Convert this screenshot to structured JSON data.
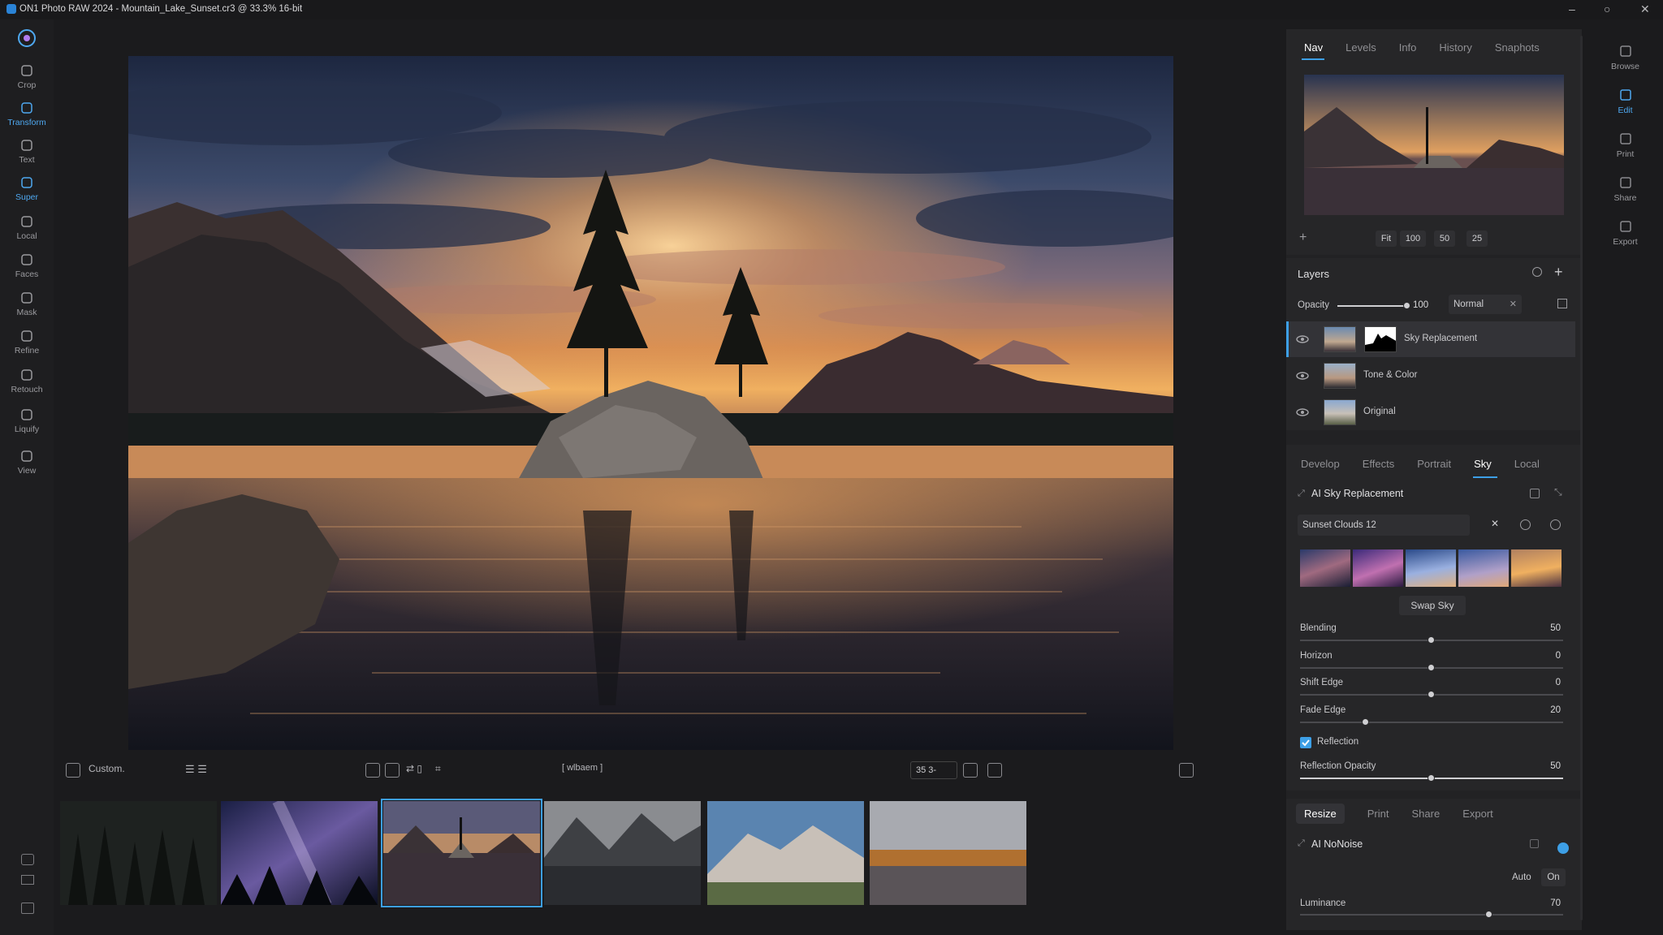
{
  "window": {
    "title": "ON1 Photo RAW 2024 - Mountain_Lake_Sunset.cr3 @ 33.3% 16-bit"
  },
  "left_tools": [
    {
      "label": "Crop",
      "icon": "crop-icon"
    },
    {
      "label": "Transform",
      "icon": "transform-icon"
    },
    {
      "label": "Text",
      "icon": "text-icon"
    },
    {
      "label": "Super",
      "icon": "super-icon"
    },
    {
      "label": "Local",
      "icon": "brush-icon"
    },
    {
      "label": "Faces",
      "icon": "face-icon"
    },
    {
      "label": "Mask",
      "icon": "mask-icon"
    },
    {
      "label": "Refine",
      "icon": "refine-brush-icon"
    },
    {
      "label": "Retouch",
      "icon": "retouch-icon"
    },
    {
      "label": "Liquify",
      "icon": "liquify-icon"
    },
    {
      "label": "View",
      "icon": "view-icon"
    }
  ],
  "right_tools": [
    {
      "label": "Browse",
      "icon": "browse-icon"
    },
    {
      "label": "Edit",
      "icon": "edit-icon"
    },
    {
      "label": "Print",
      "icon": "print-icon"
    },
    {
      "label": "Share",
      "icon": "share-icon"
    },
    {
      "label": "Export",
      "icon": "export-icon"
    }
  ],
  "viewbar": {
    "preset": "Custom.",
    "zoom_readout": "35 3-",
    "mid_label": "[ wlbaem ]"
  },
  "nav": {
    "tabs": [
      "Nav",
      "Levels",
      "Info",
      "History",
      "Snaphots"
    ],
    "zoom_buttons": [
      "Fit",
      "100",
      "50",
      "25"
    ]
  },
  "layers": {
    "title": "Layers",
    "opacity_label": "Opacity",
    "opacity_value": "100",
    "opacity_fraction": 1.0,
    "blend_mode": "Normal",
    "items": [
      {
        "name": "Sky Replacement",
        "selected": true
      },
      {
        "name": "Tone & Color",
        "selected": false
      },
      {
        "name": "Original",
        "selected": false
      }
    ]
  },
  "edit_tabs": [
    "Develop",
    "Effects",
    "Portrait",
    "Sky",
    "Local"
  ],
  "sky": {
    "title": "AI Sky Replacement",
    "preset": "Sunset Clouds 12",
    "swap_label": "Swap Sky",
    "sliders": [
      {
        "label": "Blending",
        "value": "50",
        "fraction": 0.5
      },
      {
        "label": "Horizon",
        "value": "0",
        "fraction": 0.5
      },
      {
        "label": "Shift Edge",
        "value": "0",
        "fraction": 0.5
      },
      {
        "label": "Fade Edge",
        "value": "20",
        "fraction": 0.25
      }
    ],
    "reflection_label": "Reflection",
    "reflection_checked": true,
    "reflection_opacity": {
      "label": "Reflection Opacity",
      "value": "50",
      "fraction": 0.5
    }
  },
  "bottom_tabs": [
    "Resize",
    "Print",
    "Share",
    "Export"
  ],
  "noise": {
    "title": "AI NoNoise",
    "auto_label": "Auto",
    "on_label": "On",
    "luminance": {
      "label": "Luminance",
      "value": "70",
      "fraction": 0.72
    }
  },
  "colors": {
    "accent": "#3d9fe6",
    "panel": "#262628",
    "background": "#1b1b1d"
  }
}
